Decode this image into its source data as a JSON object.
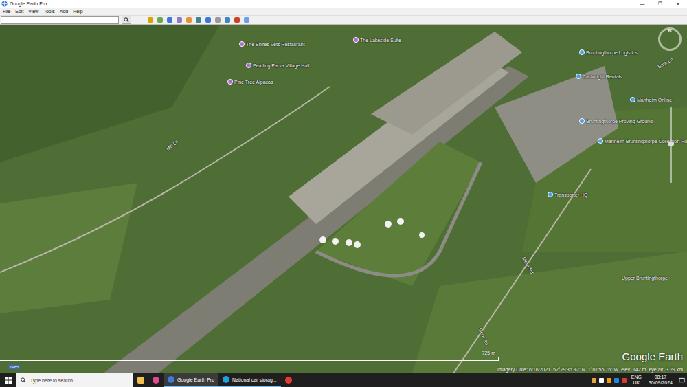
{
  "window": {
    "title": "Google Earth Pro",
    "controls": [
      "—",
      "❐",
      "✕"
    ]
  },
  "menu": [
    "File",
    "Edit",
    "View",
    "Tools",
    "Add",
    "Help"
  ],
  "places": [
    {
      "label": "The Shires Vets Restaurant",
      "color": "#b36ad6"
    },
    {
      "label": "The Lakeside Suite",
      "color": "#b36ad6"
    },
    {
      "label": "Peatling Parva Village Hall",
      "color": "#b36ad6"
    },
    {
      "label": "Pine Tree Alpacas",
      "color": "#b36ad6"
    },
    {
      "label": "Bruntingthorpe Logistics",
      "color": "#4aa3df"
    },
    {
      "label": "Cartwright Rentals",
      "color": "#4aa3df"
    },
    {
      "label": "Manheim Online",
      "color": "#4aa3df"
    },
    {
      "label": "Bruntingthorpe Proving Ground",
      "color": "#4aa3df"
    },
    {
      "label": "Manheim Bruntingthorpe Collection Hu",
      "color": "#4aa3df"
    },
    {
      "label": "Transporter HQ",
      "color": "#4aa3df"
    }
  ],
  "roads": [
    "Mill Ln",
    "Bath Ln",
    "Mere Rd",
    "Mere Rd",
    "Upper Bruntingthorpe"
  ],
  "compass": "N",
  "scale": "725 m",
  "year": "1985",
  "watermark": "Google Earth",
  "status": {
    "imagery_date": "Imagery Date: 6/16/2021",
    "lat": "52°29'36.32\" N",
    "lon": "1°07'55.76\" W",
    "elev_label": "elev",
    "elev": "142 m",
    "eye_label": "eye alt",
    "eye": "3.29 km"
  },
  "taskbar": {
    "search_placeholder": "Type here to search",
    "apps": [
      {
        "label": "Google Earth Pro",
        "selected": true
      },
      {
        "label": "National car storag...",
        "selected": false
      }
    ],
    "lang": "ENG",
    "region": "UK",
    "time": "08:17",
    "date": "30/09/2024"
  }
}
